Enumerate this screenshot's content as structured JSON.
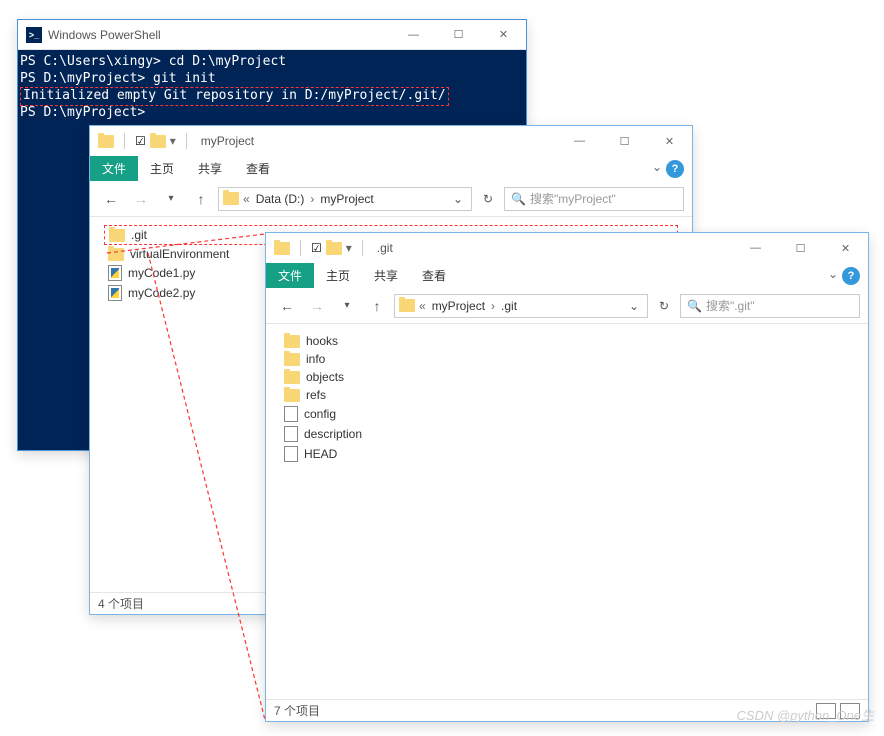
{
  "powershell": {
    "title": "Windows PowerShell",
    "lines": [
      {
        "prompt": "PS C:\\Users\\xingy>",
        "cmd": " cd D:\\myProject"
      },
      {
        "prompt": "PS D:\\myProject>",
        "cmd": " git init"
      },
      {
        "output": "Initialized empty Git repository in D:/myProject/.git/",
        "highlighted": true
      },
      {
        "prompt": "PS D:\\myProject>",
        "cmd": " "
      }
    ]
  },
  "explorer1": {
    "title": "myProject",
    "tabs": {
      "file": "文件",
      "home": "主页",
      "share": "共享",
      "view": "查看"
    },
    "address": {
      "segments": [
        "Data (D:)",
        "myProject"
      ]
    },
    "search_placeholder": "搜索\"myProject\"",
    "items": [
      {
        "name": ".git",
        "type": "folder",
        "highlighted": true
      },
      {
        "name": "virtualEnvironment",
        "type": "folder"
      },
      {
        "name": "myCode1.py",
        "type": "py"
      },
      {
        "name": "myCode2.py",
        "type": "py"
      }
    ],
    "status": "4 个项目"
  },
  "explorer2": {
    "title": ".git",
    "tabs": {
      "file": "文件",
      "home": "主页",
      "share": "共享",
      "view": "查看"
    },
    "address": {
      "segments": [
        "myProject",
        ".git"
      ]
    },
    "search_placeholder": "搜索\".git\"",
    "items": [
      {
        "name": "hooks",
        "type": "folder"
      },
      {
        "name": "info",
        "type": "folder"
      },
      {
        "name": "objects",
        "type": "folder"
      },
      {
        "name": "refs",
        "type": "folder"
      },
      {
        "name": "config",
        "type": "file"
      },
      {
        "name": "description",
        "type": "file"
      },
      {
        "name": "HEAD",
        "type": "file"
      }
    ],
    "status": "7 个项目"
  },
  "watermark": "CSDN @python_One生"
}
